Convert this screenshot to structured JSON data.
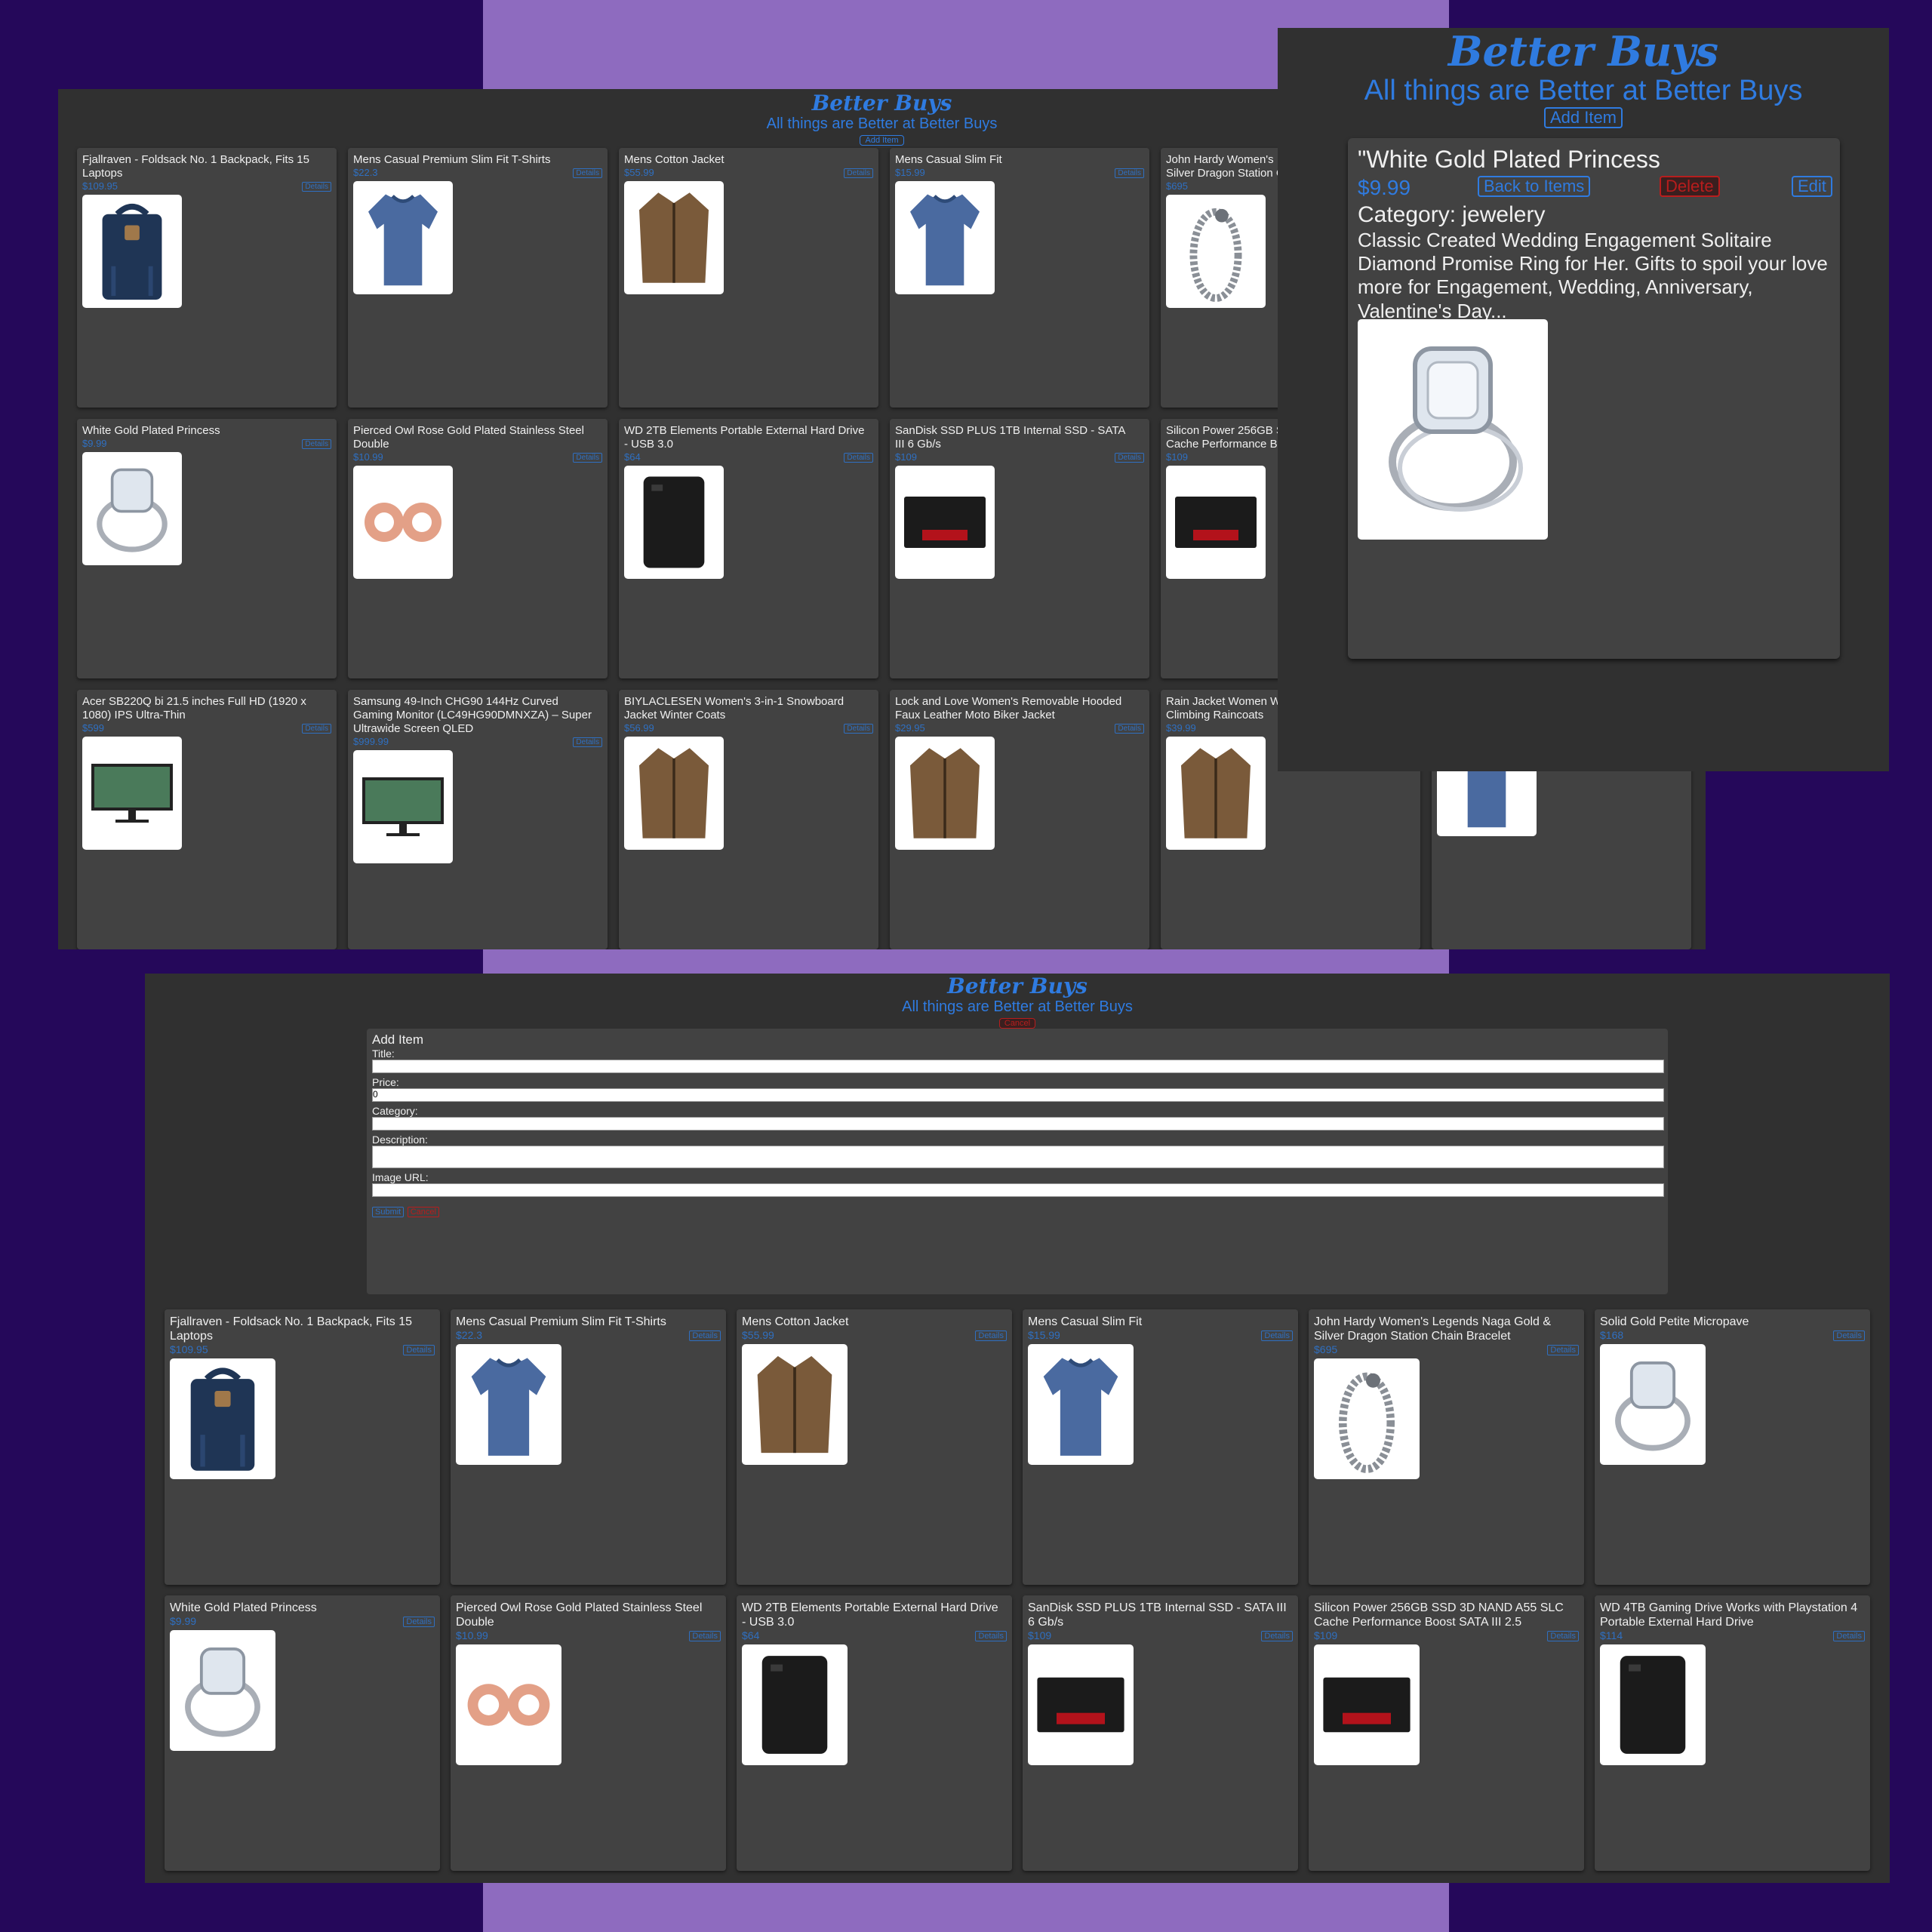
{
  "app": {
    "brand": "Better Buys",
    "tagline": "All things are Better at Better Buys",
    "add_item_label": "Add Item",
    "cancel_label": "Cancel",
    "details_label": "Details",
    "colors": {
      "accent": "#2f7be0",
      "danger": "#b81d1d",
      "background": "#303030",
      "card": "#424242"
    }
  },
  "screen_a": {
    "rows": [
      [
        {
          "title": "Fjallraven - Foldsack No. 1 Backpack, Fits 15 Laptops",
          "price": "$109.95",
          "image_icon": "backpack-icon"
        },
        {
          "title": "Mens Casual Premium Slim Fit T-Shirts",
          "price": "$22.3",
          "image_icon": "shirt-icon"
        },
        {
          "title": "Mens Cotton Jacket",
          "price": "$55.99",
          "image_icon": "jacket-icon"
        },
        {
          "title": "Mens Casual Slim Fit",
          "price": "$15.99",
          "image_icon": "shirt-icon"
        },
        {
          "title": "John Hardy Women's Legends Naga Gold & Silver Dragon Station Chain Bracelet",
          "price": "$695",
          "image_icon": "bracelet-icon"
        },
        {
          "title": "Solid Gold Petite Micropave",
          "price": "$168",
          "image_icon": "ring-icon"
        }
      ],
      [
        {
          "title": "White Gold Plated Princess",
          "price": "$9.99",
          "image_icon": "ring-icon"
        },
        {
          "title": "Pierced Owl Rose Gold Plated Stainless Steel Double",
          "price": "$10.99",
          "image_icon": "earring-icon"
        },
        {
          "title": "WD 2TB Elements Portable External Hard Drive - USB 3.0",
          "price": "$64",
          "image_icon": "harddrive-icon"
        },
        {
          "title": "SanDisk SSD PLUS 1TB Internal SSD - SATA III 6 Gb/s",
          "price": "$109",
          "image_icon": "ssd-icon"
        },
        {
          "title": "Silicon Power 256GB SSD 3D NAND A55 SLC Cache Performance Boost SATA III 2.5",
          "price": "$109",
          "image_icon": "ssd-icon"
        },
        {
          "title": "WD 4TB Gaming Drive Works with Playstation 4 Portable External Hard Drive",
          "price": "$114",
          "image_icon": "harddrive-icon"
        }
      ],
      [
        {
          "title": "Acer SB220Q bi 21.5 inches Full HD (1920 x 1080) IPS Ultra-Thin",
          "price": "$599",
          "image_icon": "monitor-icon"
        },
        {
          "title": "Samsung 49-Inch CHG90 144Hz Curved Gaming Monitor (LC49HG90DMNXZA) – Super Ultrawide Screen QLED",
          "price": "$999.99",
          "image_icon": "monitor-icon"
        },
        {
          "title": "BIYLACLESEN Women's 3-in-1 Snowboard Jacket Winter Coats",
          "price": "$56.99",
          "image_icon": "jacket-icon"
        },
        {
          "title": "Lock and Love Women's Removable Hooded Faux Leather Moto Biker Jacket",
          "price": "$29.95",
          "image_icon": "jacket-icon"
        },
        {
          "title": "Rain Jacket Women Windbreaker Striped Climbing Raincoats",
          "price": "$39.99",
          "image_icon": "jacket-icon"
        },
        {
          "title": "",
          "price": "",
          "image_icon": "shirt-icon"
        }
      ]
    ]
  },
  "detail": {
    "title": "\"White Gold Plated Princess",
    "price": "$9.99",
    "back_label": "Back to Items",
    "delete_label": "Delete",
    "edit_label": "Edit",
    "category": "Category: jewelery",
    "description": "Classic Created Wedding Engagement Solitaire Diamond Promise Ring for Her. Gifts to spoil your love more for Engagement, Wedding, Anniversary, Valentine's Day...",
    "image_icon": "ring-icon"
  },
  "form": {
    "heading": "Add Item",
    "title_label": "Title:",
    "title_value": "",
    "price_label": "Price:",
    "price_value": "0",
    "category_label": "Category:",
    "category_value": "",
    "description_label": "Description:",
    "description_value": "",
    "image_label": "Image URL:",
    "image_value": "",
    "submit_label": "Submit",
    "cancel_label": "Cancel"
  },
  "screen_c": {
    "rows": [
      [
        {
          "title": "Fjallraven - Foldsack No. 1 Backpack, Fits 15 Laptops",
          "price": "$109.95",
          "image_icon": "backpack-icon"
        },
        {
          "title": "Mens Casual Premium Slim Fit T-Shirts",
          "price": "$22.3",
          "image_icon": "shirt-icon"
        },
        {
          "title": "Mens Cotton Jacket",
          "price": "$55.99",
          "image_icon": "jacket-icon"
        },
        {
          "title": "Mens Casual Slim Fit",
          "price": "$15.99",
          "image_icon": "shirt-icon"
        },
        {
          "title": "John Hardy Women's Legends Naga Gold & Silver Dragon Station Chain Bracelet",
          "price": "$695",
          "image_icon": "bracelet-icon"
        },
        {
          "title": "Solid Gold Petite Micropave",
          "price": "$168",
          "image_icon": "ring-icon"
        }
      ],
      [
        {
          "title": "White Gold Plated Princess",
          "price": "$9.99",
          "image_icon": "ring-icon"
        },
        {
          "title": "Pierced Owl Rose Gold Plated Stainless Steel Double",
          "price": "$10.99",
          "image_icon": "earring-icon"
        },
        {
          "title": "WD 2TB Elements Portable External Hard Drive - USB 3.0",
          "price": "$64",
          "image_icon": "harddrive-icon"
        },
        {
          "title": "SanDisk SSD PLUS 1TB Internal SSD - SATA III 6 Gb/s",
          "price": "$109",
          "image_icon": "ssd-icon"
        },
        {
          "title": "Silicon Power 256GB SSD 3D NAND A55 SLC Cache Performance Boost SATA III 2.5",
          "price": "$109",
          "image_icon": "ssd-icon"
        },
        {
          "title": "WD 4TB Gaming Drive Works with Playstation 4 Portable External Hard Drive",
          "price": "$114",
          "image_icon": "harddrive-icon"
        }
      ]
    ]
  }
}
